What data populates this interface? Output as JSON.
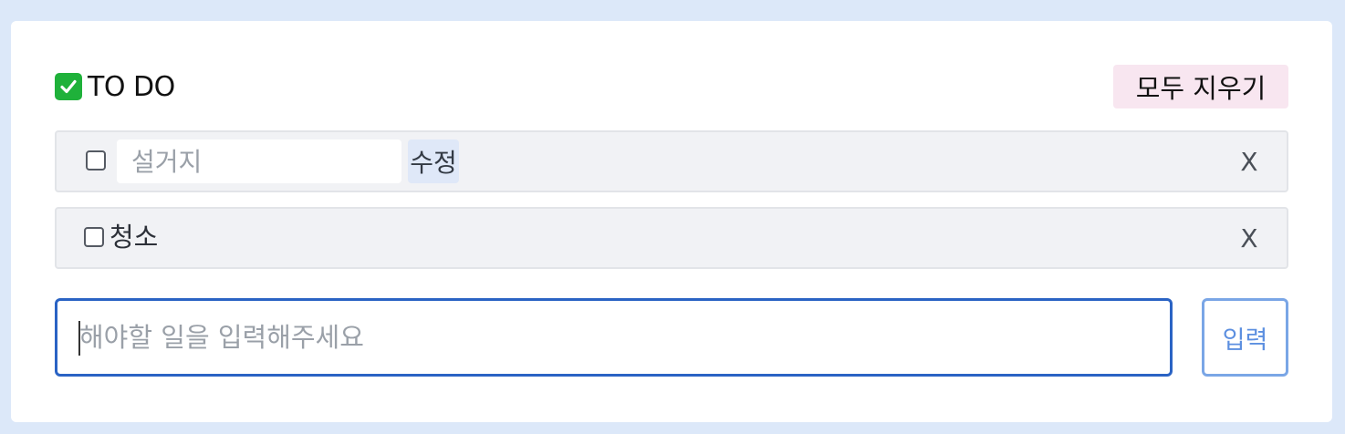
{
  "header": {
    "title": "TO DO",
    "title_icon": "check-mark-icon",
    "clear_all_label": "모두 지우기"
  },
  "todos": [
    {
      "checked": false,
      "editing": true,
      "edit_placeholder": "설거지",
      "edit_value": "",
      "edit_button_label": "수정",
      "delete_label": "X"
    },
    {
      "checked": false,
      "editing": false,
      "text": "청소",
      "delete_label": "X"
    }
  ],
  "new_todo": {
    "placeholder": "해야할 일을 입력해주세요",
    "value": "",
    "submit_label": "입력"
  },
  "colors": {
    "page_background": "#dce8f9",
    "clear_all_background": "#f8e6f0",
    "input_border_focus": "#2a63c4",
    "submit_border": "#7aa6e6",
    "check_icon": "#1fb13a"
  }
}
